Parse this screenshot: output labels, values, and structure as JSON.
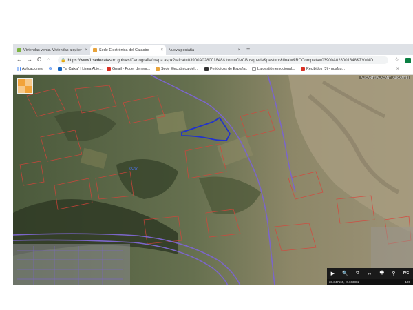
{
  "tabs": [
    {
      "label": "Viviendas venta. Viviendas alquiler",
      "fav_color": "#7cb342",
      "fav_text": "id",
      "active": false
    },
    {
      "label": "Sede Electrónica del Catastro",
      "fav_color": "#e8a33a",
      "active": true
    },
    {
      "label": "Nueva pestaña",
      "fav_color": "",
      "active": false
    }
  ],
  "close_glyph": "×",
  "new_tab_glyph": "+",
  "toolbar": {
    "back": "←",
    "forward": "→",
    "reload": "C",
    "home": "⌂",
    "lock": "🔒",
    "url_host": "https://www1.sedecatastro.gob.es",
    "url_path": "/Cartografia/mapa.aspx?refcat=03900A028001848&from=OVCBusqueda&pest=rc&final=&RCCompleta=03900A028001848&ZV=NO...",
    "star": "☆"
  },
  "bookmarks": [
    {
      "label": "Aplicaciones",
      "color": "#8ab4f8"
    },
    {
      "label": "G",
      "color": ""
    },
    {
      "label": "\"la Caixa\" | Línea Abie...",
      "color": "#1565c0"
    },
    {
      "label": "Gmail - Poder de repr...",
      "color": "#d93025"
    },
    {
      "label": "Sede Electrónica del ...",
      "color": "#e8a33a"
    },
    {
      "label": "Periódicos de España...",
      "color": "#333333"
    },
    {
      "label": "La gestión emocional...",
      "color": "#bbbbbb"
    },
    {
      "label": "Recibidos (3) - gdsfsg...",
      "color": "#d93025"
    }
  ],
  "more_glyph": "»",
  "map": {
    "region_label": "ALICANTE/ALACANT (ALICANTE)",
    "parcel_number": "028",
    "tools": [
      "▶",
      "🔍",
      "⧉",
      "↔",
      "🖶",
      "⚲",
      "IVG"
    ],
    "coords": "38.347565, -0.603882",
    "scale": "100"
  }
}
